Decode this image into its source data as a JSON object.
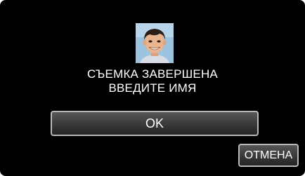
{
  "dialog": {
    "photo": "child-face-photo",
    "message_line1": "СЪЕМКА ЗАВЕРШЕНА",
    "message_line2": "ВВЕДИТЕ ИМЯ"
  },
  "buttons": {
    "ok_label": "OK",
    "cancel_label": "ОТМЕНА"
  },
  "colors": {
    "background": "#000000",
    "text": "#ffffff",
    "button_border": "#b9b9b9",
    "button_fill": "#3c3c3c"
  }
}
